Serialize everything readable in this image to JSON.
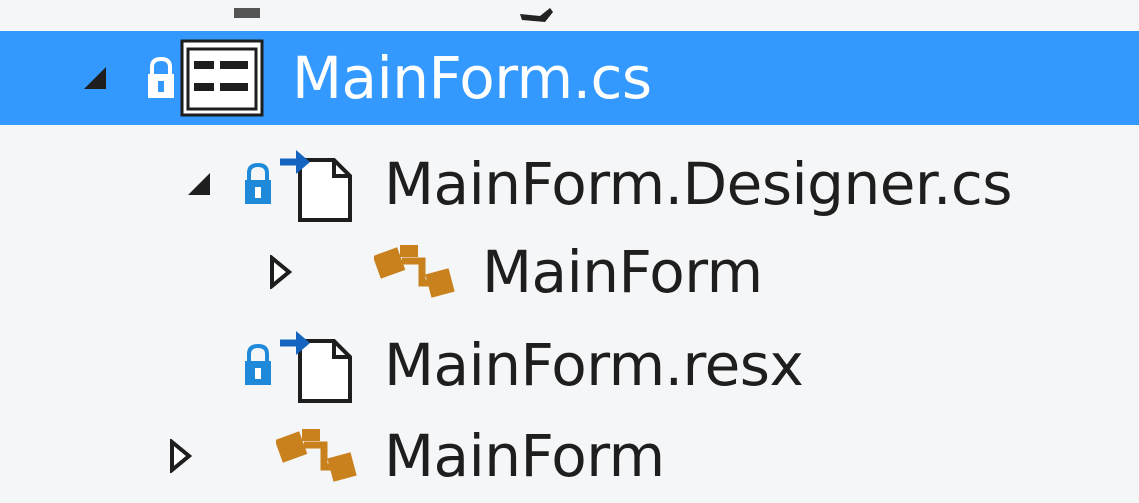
{
  "tree": {
    "items": [
      {
        "label": "MainForm.cs",
        "selected": true,
        "expanded": true,
        "icon": "windows-form-icon",
        "locked": true
      },
      {
        "label": "MainForm.Designer.cs",
        "selected": false,
        "expanded": true,
        "icon": "csharp-file-icon",
        "locked": true
      },
      {
        "label": "MainForm",
        "selected": false,
        "expanded": false,
        "icon": "class-icon",
        "locked": false
      },
      {
        "label": "MainForm.resx",
        "selected": false,
        "expanded": null,
        "icon": "resx-file-icon",
        "locked": true
      },
      {
        "label": "MainForm",
        "selected": false,
        "expanded": false,
        "icon": "class-icon",
        "locked": false
      }
    ]
  },
  "colors": {
    "selection": "#3399ff",
    "lock": "#1f8ad9",
    "arrow": "#1565c0",
    "class": "#c8811d",
    "text": "#1e1e1e"
  }
}
